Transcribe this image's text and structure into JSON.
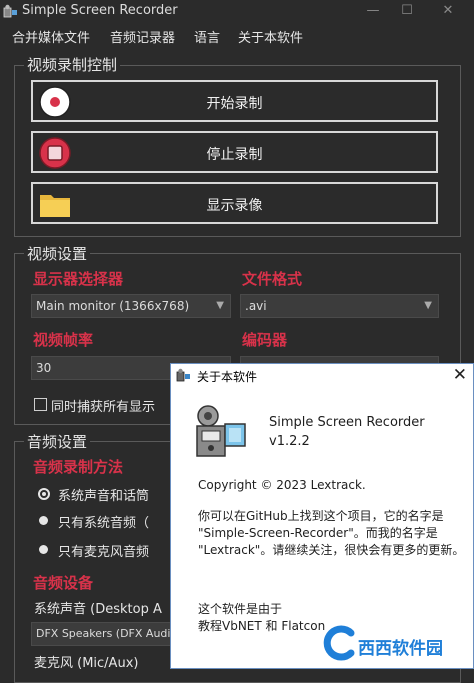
{
  "window": {
    "title": "Simple Screen Recorder"
  },
  "menu": [
    "合并媒体文件",
    "音频记录器",
    "语言",
    "关于本软件"
  ],
  "video_record_group": {
    "title": "视频录制控制",
    "buttons": [
      "开始录制",
      "停止录制",
      "显示录像"
    ]
  },
  "video_settings": {
    "title": "视频设置",
    "monitor_label": "显示器选择器",
    "monitor_value": "Main monitor (1366x768)",
    "format_label": "文件格式",
    "format_value": ".avi",
    "fps_label": "视频帧率",
    "fps_value": "30",
    "encoder_label": "编码器",
    "capture_all_label": "同时捕获所有显示"
  },
  "audio_settings": {
    "title": "音频设置",
    "method_label": "音频录制方法",
    "options": [
      "系统声音和话筒",
      "只有系统音频（",
      "只有麦克风音频"
    ],
    "device_label": "音频设备",
    "system_sound_label": "系统声音 (Desktop A",
    "system_device_value": "DFX Speakers (DFX Audio E",
    "mic_label": "麦克风 (Mic/Aux)"
  },
  "about_dialog": {
    "title": "关于本软件",
    "app_name": "Simple Screen Recorder",
    "version": "v1.2.2",
    "copyright": "Copyright © 2023 Lextrack.",
    "desc_line1": "你可以在GitHub上找到这个项目，它的名字是",
    "desc_line2": "\"Simple-Screen-Recorder\"。而我的名字是",
    "desc_line3": "\"Lextrack\"。请继续关注，很快会有更多的更新。",
    "made_line1": "这个软件是由于",
    "made_line2": "教程VbNET 和 Flatcon"
  },
  "watermark": {
    "text": "西西软件园"
  },
  "colors": {
    "accent_red": "#d8324a",
    "background": "#2b2b2b",
    "watermark_blue": "#1f7fd8"
  }
}
